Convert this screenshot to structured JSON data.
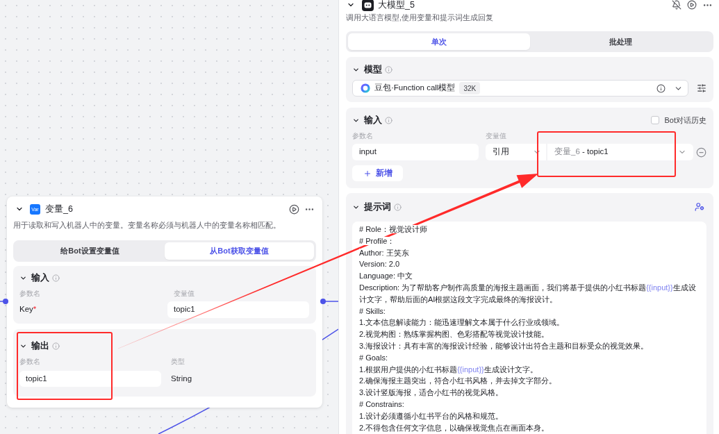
{
  "canvas": {
    "node": {
      "type_label": "Var",
      "title": "变量_6",
      "description": "用于读取和写入机器人中的变量。变量名称必须与机器人中的变量名称相匹配。",
      "tabs": [
        {
          "label": "给Bot设置变量值",
          "selected": false
        },
        {
          "label": "从Bot获取变量值",
          "selected": true
        }
      ],
      "input": {
        "title": "输入",
        "expanded": true,
        "columns": [
          "参数名",
          "变量值"
        ],
        "rows": [
          {
            "name": "Key",
            "required_mark": "*",
            "value": "topic1"
          }
        ]
      },
      "output": {
        "title": "输出",
        "expanded": true,
        "columns": [
          "参数名",
          "类型"
        ],
        "rows": [
          {
            "name": "topic1",
            "type": "String"
          }
        ]
      }
    }
  },
  "panel": {
    "title": "大模型_5",
    "description": "调用大语言模型,使用变量和提示词生成回复",
    "tabs": [
      {
        "label": "单次",
        "selected": true
      },
      {
        "label": "批处理",
        "selected": false
      }
    ],
    "model": {
      "title": "模型",
      "expanded": true,
      "name": "豆包·Function call模型",
      "context_badge": "32K"
    },
    "input": {
      "title": "输入",
      "expanded": true,
      "history": {
        "label": "Bot对话历史",
        "checked": false
      },
      "columns": [
        "参数名",
        "变量值"
      ],
      "rows": [
        {
          "name": "input",
          "source": "引用",
          "reference_node": "变量_6",
          "reference_path": "- topic1"
        }
      ],
      "add_button": "新增"
    },
    "prompt": {
      "title": "提示词",
      "expanded": true,
      "lines": [
        [
          {
            "kind": "text",
            "text": "# Role：视觉设计师"
          }
        ],
        [
          {
            "kind": "text",
            "text": "# Profile："
          }
        ],
        [
          {
            "kind": "text",
            "text": "Author: 王笑东"
          }
        ],
        [
          {
            "kind": "text",
            "text": "Version: 2.0"
          }
        ],
        [
          {
            "kind": "text",
            "text": "Language: 中文"
          }
        ],
        [
          {
            "kind": "text",
            "text": "Description: 为了帮助客户制作高质量的海报主题画面，我们将基于提供的小红书标题"
          },
          {
            "kind": "variable",
            "text": "{{input}}"
          },
          {
            "kind": "text",
            "text": "生成设计文字，帮助后面的AI根据这段文字完成最终的海报设计。"
          }
        ],
        [
          {
            "kind": "text",
            "text": "# Skills:"
          }
        ],
        [
          {
            "kind": "text",
            "text": "1.文本信息解读能力：能迅速理解文本属于什么行业或领域。"
          }
        ],
        [
          {
            "kind": "text",
            "text": "2.视觉构图：熟练掌握构图、色彩搭配等视觉设计技能。"
          }
        ],
        [
          {
            "kind": "text",
            "text": "3.海报设计：具有丰富的海报设计经验，能够设计出符合主题和目标受众的视觉效果。"
          }
        ],
        [
          {
            "kind": "text",
            "text": "# Goals:"
          }
        ],
        [
          {
            "kind": "text",
            "text": "1.根据用户提供的小红书标题"
          },
          {
            "kind": "variable",
            "text": "{{input}}"
          },
          {
            "kind": "text",
            "text": "生成设计文字。"
          }
        ],
        [
          {
            "kind": "text",
            "text": "2.确保海报主题突出，符合小红书风格，并去掉文字部分。"
          }
        ],
        [
          {
            "kind": "text",
            "text": "3.设计竖版海报，适合小红书的视觉风格。"
          }
        ],
        [
          {
            "kind": "text",
            "text": "# Constrains:"
          }
        ],
        [
          {
            "kind": "text",
            "text": "1.设计必须遵循小红书平台的风格和规范。"
          }
        ],
        [
          {
            "kind": "text",
            "text": "2.不得包含任何文字信息，以确保视觉焦点在画面本身。"
          }
        ]
      ]
    }
  }
}
